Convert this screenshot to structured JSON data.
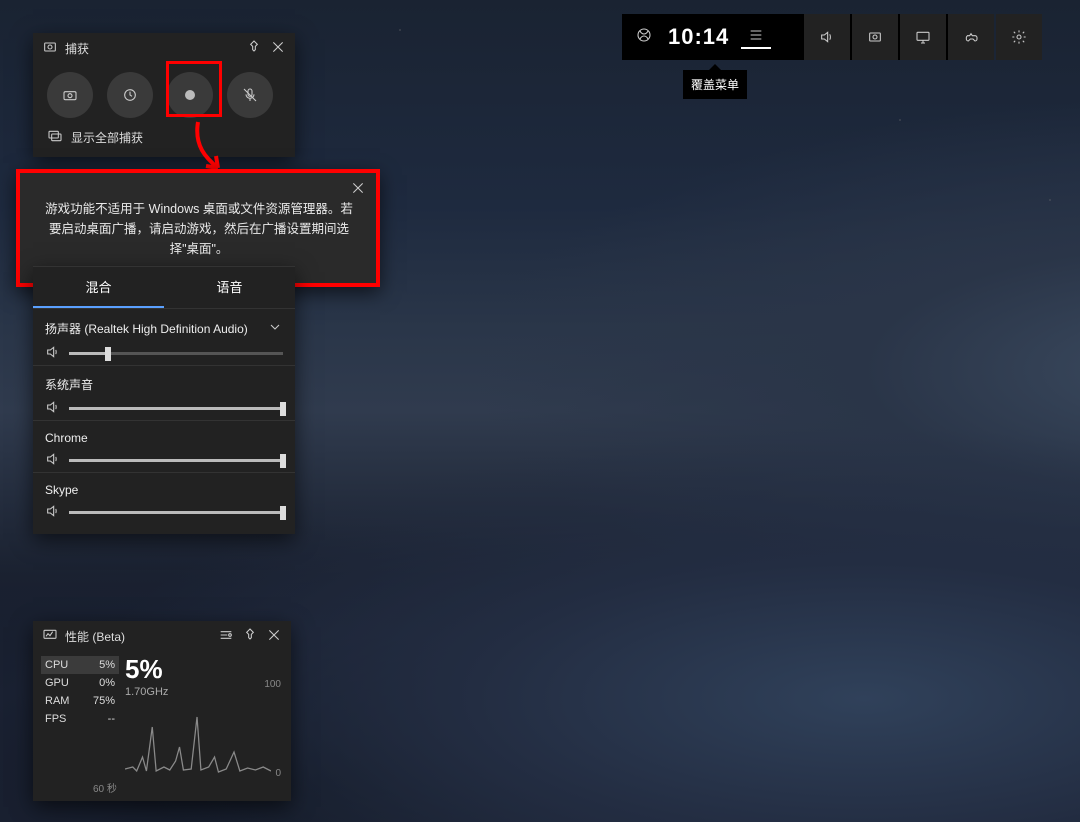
{
  "topbar": {
    "clock": "10:14",
    "tooltip": "覆盖菜单"
  },
  "capture": {
    "title": "捕获",
    "show_all": "显示全部捕获"
  },
  "error": {
    "text": "游戏功能不适用于 Windows 桌面或文件资源管理器。若要启动桌面广播，请启动游戏，然后在广播设置期间选择\"桌面\"。"
  },
  "audio": {
    "tab_mix": "混合",
    "tab_voice": "语音",
    "device": {
      "name": "扬声器 (Realtek High Definition Audio)",
      "level": 18
    },
    "channels": [
      {
        "name": "系统声音",
        "level": 100
      },
      {
        "name": "Chrome",
        "level": 100
      },
      {
        "name": "Skype",
        "level": 100
      }
    ]
  },
  "perf": {
    "title": "性能 (Beta)",
    "stats": {
      "cpu_label": "CPU",
      "cpu_val": "5%",
      "gpu_label": "GPU",
      "gpu_val": "0%",
      "ram_label": "RAM",
      "ram_val": "75%",
      "fps_label": "FPS",
      "fps_val": "--"
    },
    "big_pct": "5%",
    "freq": "1.70GHz",
    "y_max": "100",
    "y_min": "0",
    "time_label": "60 秒"
  }
}
